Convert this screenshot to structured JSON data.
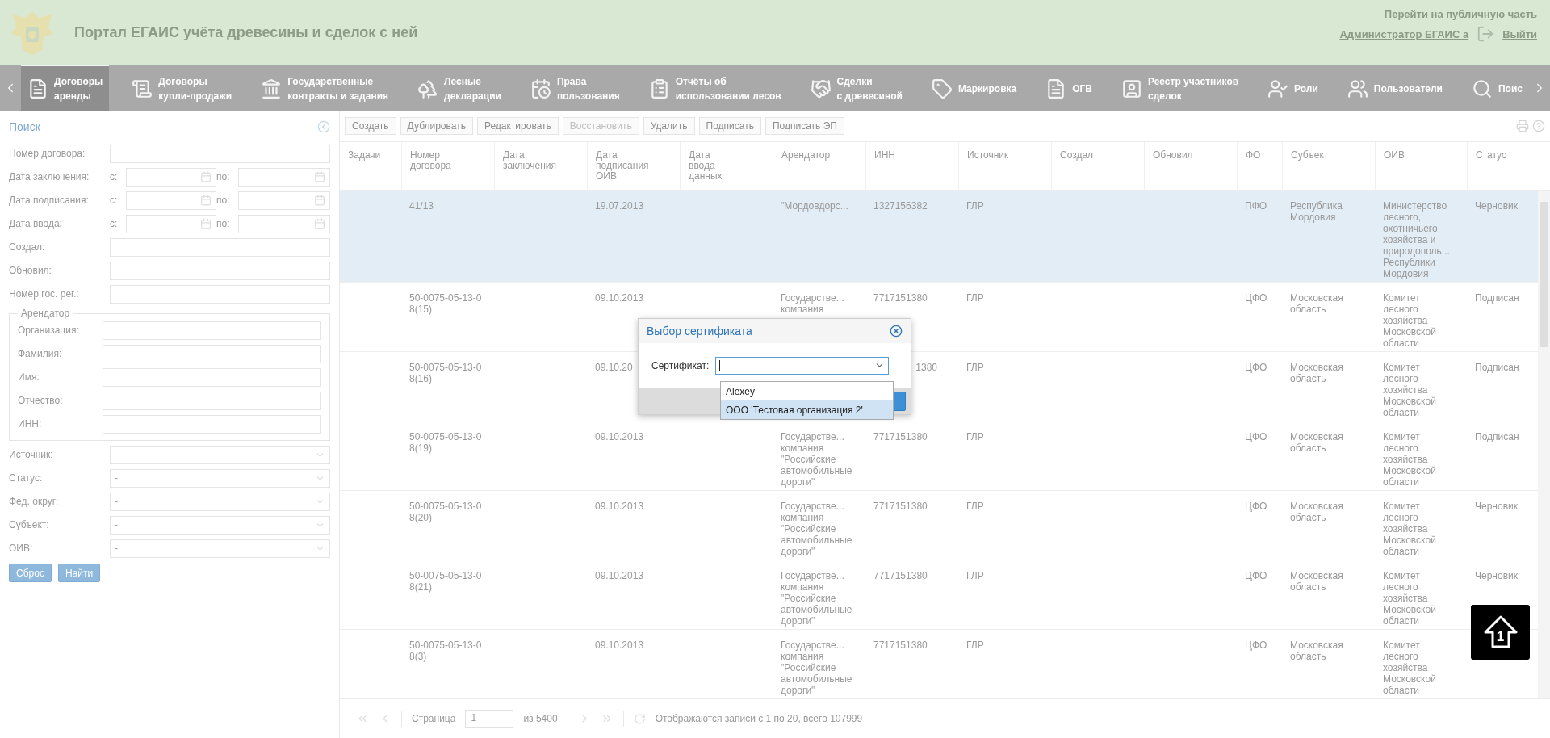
{
  "header": {
    "title": "Портал ЕГАИС учёта древесины и сделок с ней",
    "public_link": "Перейти на публичную часть",
    "user": "Администратор ЕГАИС а",
    "logout": "Выйти"
  },
  "nav": {
    "items": [
      {
        "label": "Договоры\nаренды",
        "selected": true
      },
      {
        "label": "Договоры\nкупли-продажи",
        "selected": false
      },
      {
        "label": "Государственные\nконтракты и задания",
        "selected": false
      },
      {
        "label": "Лесные\nдекларации",
        "selected": false
      },
      {
        "label": "Права\nпользования",
        "selected": false
      },
      {
        "label": "Отчёты об\nиспользовании лесов",
        "selected": false
      },
      {
        "label": "Сделки\nс древесиной",
        "selected": false
      },
      {
        "label": "Маркировка",
        "selected": false
      },
      {
        "label": "ОГВ",
        "selected": false
      },
      {
        "label": "Реестр участников\nсделок",
        "selected": false
      },
      {
        "label": "Роли",
        "selected": false
      },
      {
        "label": "Пользователи",
        "selected": false
      },
      {
        "label": "Поис",
        "selected": false
      }
    ]
  },
  "search": {
    "title": "Поиск",
    "fields": [
      {
        "kind": "text",
        "label": "Номер договора:"
      },
      {
        "kind": "range",
        "label": "Дата заключения:",
        "from": "с:",
        "to": "по:"
      },
      {
        "kind": "range",
        "label": "Дата подписания:",
        "from": "с:",
        "to": "по:"
      },
      {
        "kind": "range",
        "label": "Дата ввода:",
        "from": "с:",
        "to": "по:"
      },
      {
        "kind": "text",
        "label": "Создал:"
      },
      {
        "kind": "text",
        "label": "Обновил:"
      },
      {
        "kind": "text",
        "label": "Номер гос. рег.:"
      },
      {
        "kind": "group",
        "legend": "Арендатор",
        "fields": [
          {
            "label": "Организация:"
          },
          {
            "label": "Фамилия:"
          },
          {
            "label": "Имя:"
          },
          {
            "label": "Отчество:"
          },
          {
            "label": "ИНН:"
          }
        ]
      },
      {
        "kind": "select",
        "label": "Источник:"
      },
      {
        "kind": "select",
        "label": "Статус:",
        "value": "-"
      },
      {
        "kind": "select",
        "label": "Фед. округ:",
        "value": "-"
      },
      {
        "kind": "select",
        "label": "Субъект:",
        "value": "-"
      },
      {
        "kind": "select",
        "label": "ОИВ:",
        "value": "-"
      }
    ],
    "buttons": [
      "Сброс",
      "Найти"
    ]
  },
  "toolbar": [
    {
      "label": "Создать",
      "disabled": false
    },
    {
      "label": "Дублировать",
      "disabled": false
    },
    {
      "label": "Редактировать",
      "disabled": false
    },
    {
      "label": "Восстановить",
      "disabled": true
    },
    {
      "label": "Удалить",
      "disabled": false
    },
    {
      "label": "Подписать",
      "disabled": false
    },
    {
      "label": "Подписать ЭП",
      "disabled": false
    }
  ],
  "table": {
    "columns": [
      {
        "label": "Задачи"
      },
      {
        "label": "Номер\nдоговора"
      },
      {
        "label": "Дата\nзаключения"
      },
      {
        "label": "Дата\nподписания\nОИВ"
      },
      {
        "label": "Дата\nввода\nданных"
      },
      {
        "label": "Арендатор"
      },
      {
        "label": "ИНН"
      },
      {
        "label": "Источник"
      },
      {
        "label": "Создал"
      },
      {
        "label": "Обновил"
      },
      {
        "label": "ФО"
      },
      {
        "label": "Субъект"
      },
      {
        "label": "ОИВ"
      },
      {
        "label": "Статус"
      }
    ],
    "rows": [
      {
        "selected": true,
        "cells": {
          "number": "41/13",
          "signed": "19.07.2013",
          "tenant": "\"Мордовдорс...",
          "inn": "1327156382",
          "source": "ГЛР",
          "fo": "ПФО",
          "subject": "Республика\nМордовия",
          "oiv": "Министерство\nлесного,\nохотничьего\nхозяйства и\nприродополь...\nРеспублики\nМордовия",
          "status": "Черновик"
        }
      },
      {
        "selected": false,
        "cells": {
          "number": "50-0075-05-13-0\n8(15)",
          "signed": "09.10.2013",
          "tenant": "Государстве...\nкомпания",
          "inn": "7717151380",
          "source": "ГЛР",
          "fo": "ЦФО",
          "subject": "Московская\nобласть",
          "oiv": "Комитет\nлесного\nхозяйства\nМосковской\nобласти",
          "status": "Подписан"
        }
      },
      {
        "selected": false,
        "inn_cut": true,
        "cells": {
          "number": "50-0075-05-13-0\n8(16)",
          "signed": "09.10.20",
          "inn": "1380",
          "source": "ГЛР",
          "fo": "ЦФО",
          "subject": "Московская\nобласть",
          "oiv": "Комитет\nлесного\nхозяйства\nМосковской\nобласти",
          "status": "Подписан"
        }
      },
      {
        "selected": false,
        "cells": {
          "number": "50-0075-05-13-0\n8(19)",
          "signed": "09.10.2013",
          "tenant": "Государстве...\nкомпания\n\"Российские\nавтомобильные\nдороги\"",
          "inn": "7717151380",
          "source": "ГЛР",
          "fo": "ЦФО",
          "subject": "Московская\nобласть",
          "oiv": "Комитет\nлесного\nхозяйства\nМосковской\nобласти",
          "status": "Подписан"
        }
      },
      {
        "selected": false,
        "cells": {
          "number": "50-0075-05-13-0\n8(20)",
          "signed": "09.10.2013",
          "tenant": "Государстве...\nкомпания\n\"Российские\nавтомобильные\nдороги\"",
          "inn": "7717151380",
          "source": "ГЛР",
          "fo": "ЦФО",
          "subject": "Московская\nобласть",
          "oiv": "Комитет\nлесного\nхозяйства\nМосковской\nобласти",
          "status": "Черновик"
        }
      },
      {
        "selected": false,
        "cells": {
          "number": "50-0075-05-13-0\n8(21)",
          "signed": "09.10.2013",
          "tenant": "Государстве...\nкомпания\n\"Российские\nавтомобильные\nдороги\"",
          "inn": "7717151380",
          "source": "ГЛР",
          "fo": "ЦФО",
          "subject": "Московская\nобласть",
          "oiv": "Комитет\nлесного\nхозяйства\nМосковской\nобласти",
          "status": "Черновик"
        }
      },
      {
        "selected": false,
        "cells": {
          "number": "50-0075-05-13-0\n8(3)",
          "signed": "09.10.2013",
          "tenant": "Государстве...\nкомпания\n\"Российские\nавтомобильные\nдороги\"",
          "inn": "7717151380",
          "source": "ГЛР",
          "fo": "ЦФО",
          "subject": "Московская\nобласть",
          "oiv": "Комитет\nлесного\nхозяйства\nМосковской\nобласти"
        }
      }
    ]
  },
  "pagination": {
    "page_label": "Страница",
    "page": "1",
    "of": "из 5400",
    "summary": "Отображаются записи с 1 по 20, всего 107999"
  },
  "scroll_top": {
    "label": "1"
  },
  "dialog": {
    "title": "Выбор сертификата",
    "field_label": "Сертификат:",
    "options": [
      {
        "label": "Alexey",
        "selected": false
      },
      {
        "label": "ООО 'Тестовая организация 2'",
        "selected": true
      }
    ]
  }
}
